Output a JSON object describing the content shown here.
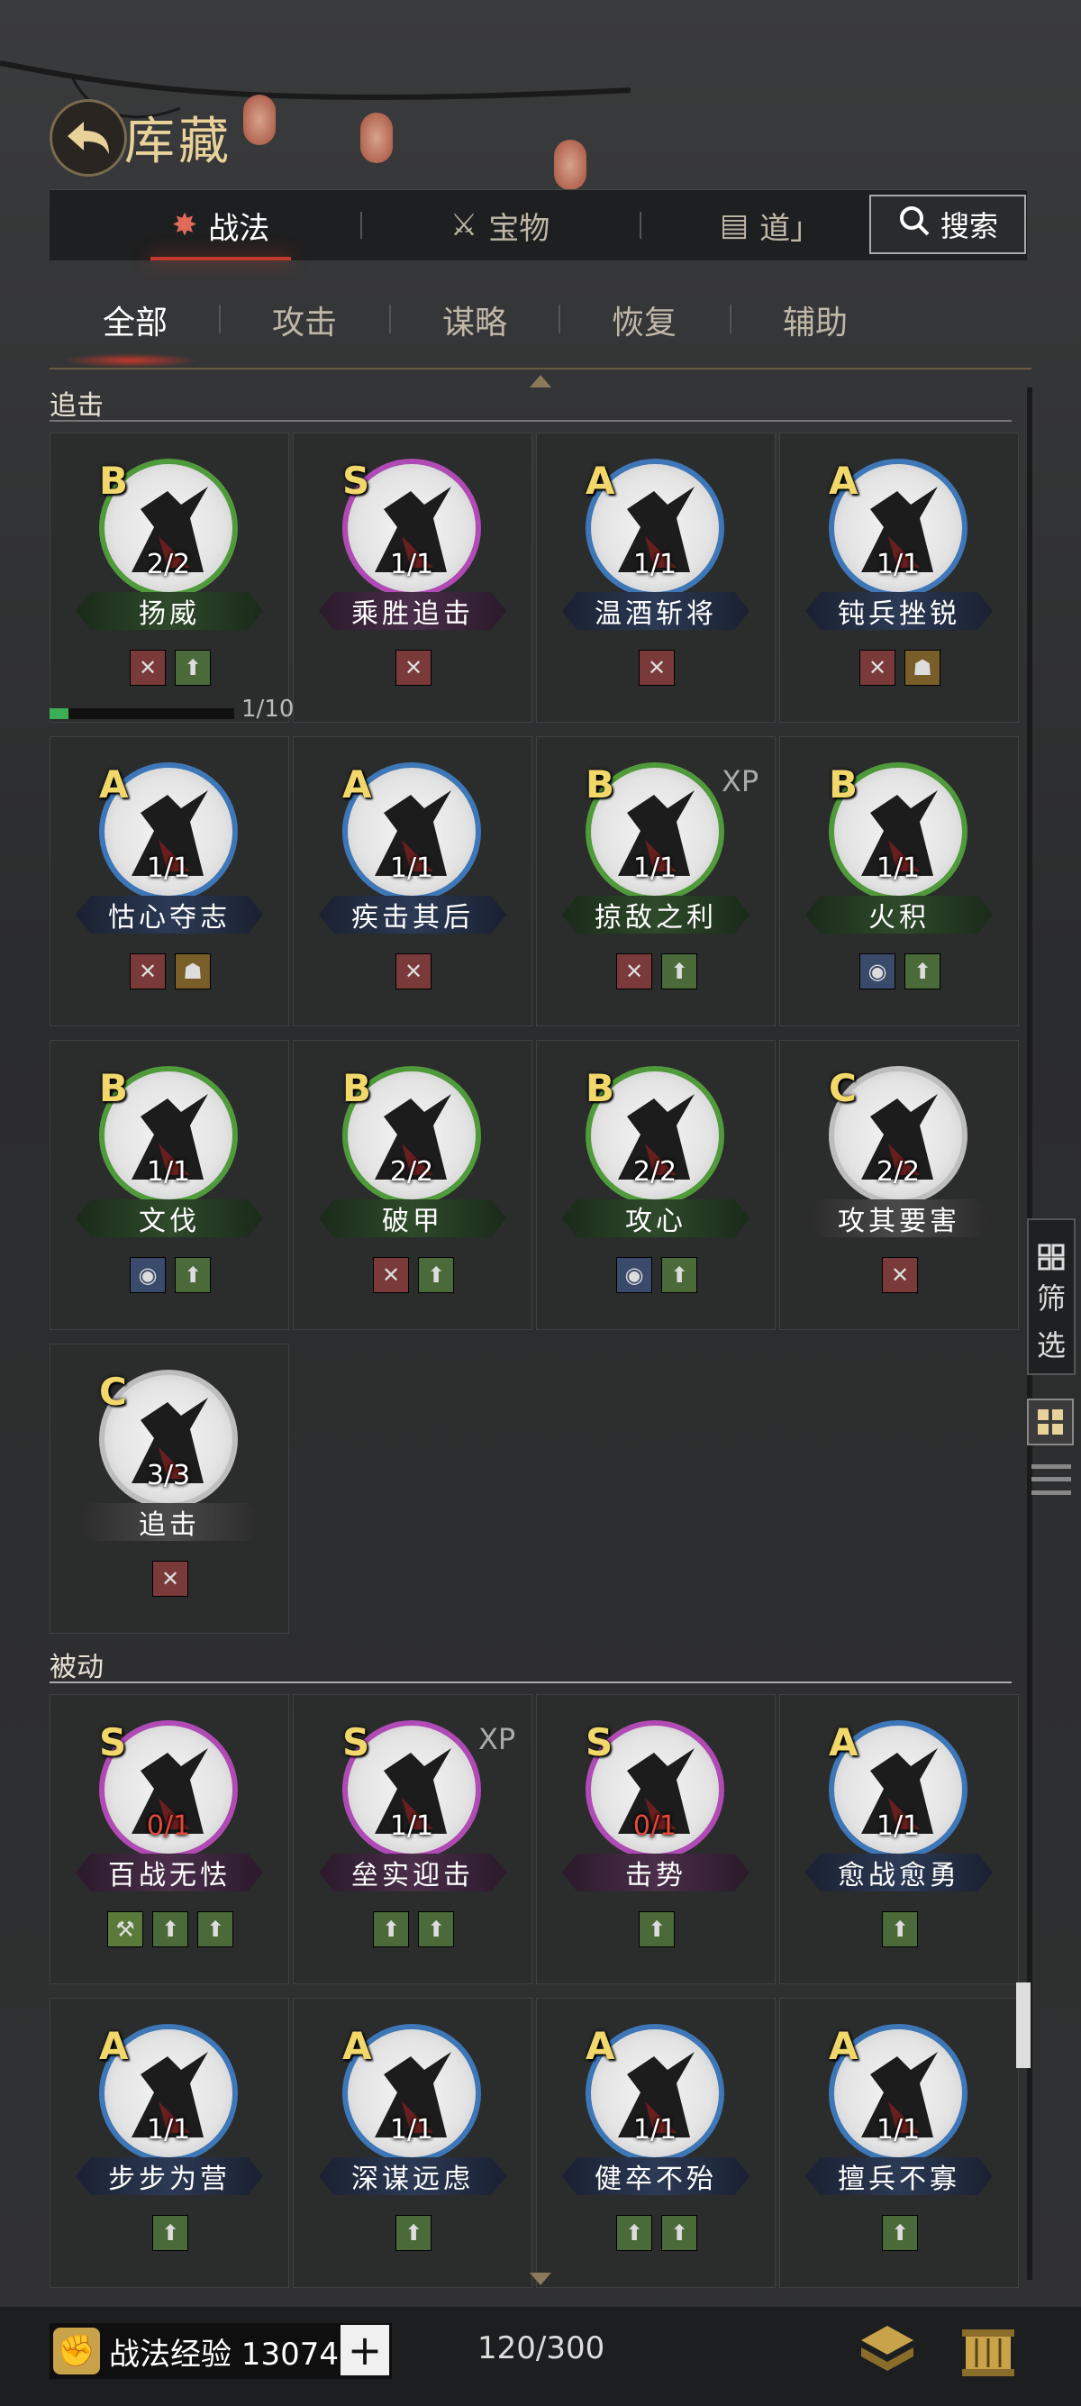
{
  "header": {
    "title": "库藏"
  },
  "tabs": [
    {
      "label": "战法",
      "active": true
    },
    {
      "label": "宝物",
      "active": false
    },
    {
      "label": "道」",
      "active": false
    }
  ],
  "search": {
    "label": "搜索"
  },
  "subtabs": [
    {
      "label": "全部",
      "active": true
    },
    {
      "label": "攻击",
      "active": false
    },
    {
      "label": "谋略",
      "active": false
    },
    {
      "label": "恢复",
      "active": false
    },
    {
      "label": "辅助",
      "active": false
    }
  ],
  "sections": [
    {
      "label": "追击",
      "cards": [
        {
          "grade": "B",
          "count": "2/2",
          "name": "扬威",
          "tags": [
            "red",
            "green"
          ],
          "progress": {
            "value": 0.1,
            "text": "1/10"
          }
        },
        {
          "grade": "S",
          "count": "1/1",
          "name": "乘胜追击",
          "tags": [
            "red"
          ]
        },
        {
          "grade": "A",
          "count": "1/1",
          "name": "温酒斩将",
          "tags": [
            "red"
          ]
        },
        {
          "grade": "A",
          "count": "1/1",
          "name": "钝兵挫锐",
          "tags": [
            "red",
            "gold"
          ]
        },
        {
          "grade": "A",
          "count": "1/1",
          "name": "怙心夺志",
          "tags": [
            "red",
            "gold"
          ]
        },
        {
          "grade": "A",
          "count": "1/1",
          "name": "疾击其后",
          "tags": [
            "red"
          ]
        },
        {
          "grade": "B",
          "count": "1/1",
          "name": "掠敌之利",
          "tags": [
            "red",
            "green"
          ],
          "xp": "XP"
        },
        {
          "grade": "B",
          "count": "1/1",
          "name": "火积",
          "tags": [
            "blue",
            "green"
          ]
        },
        {
          "grade": "B",
          "count": "1/1",
          "name": "文伐",
          "tags": [
            "blue",
            "green"
          ]
        },
        {
          "grade": "B",
          "count": "2/2",
          "name": "破甲",
          "tags": [
            "red",
            "green"
          ]
        },
        {
          "grade": "B",
          "count": "2/2",
          "name": "攻心",
          "tags": [
            "blue",
            "green"
          ]
        },
        {
          "grade": "C",
          "count": "2/2",
          "name": "攻其要害",
          "tags": [
            "red"
          ]
        },
        {
          "grade": "C",
          "count": "3/3",
          "name": "追击",
          "tags": [
            "red"
          ]
        }
      ]
    },
    {
      "label": "被动",
      "cards": [
        {
          "grade": "S",
          "count": "0/1",
          "name": "百战无怯",
          "tags": [
            "olive",
            "green",
            "green"
          ],
          "red_count": true
        },
        {
          "grade": "S",
          "count": "1/1",
          "name": "垒实迎击",
          "tags": [
            "green",
            "green"
          ],
          "xp": "XP"
        },
        {
          "grade": "S",
          "count": "0/1",
          "name": "击势",
          "tags": [
            "green"
          ],
          "red_count": true
        },
        {
          "grade": "A",
          "count": "1/1",
          "name": "愈战愈勇",
          "tags": [
            "green"
          ]
        },
        {
          "grade": "A",
          "count": "1/1",
          "name": "步步为营",
          "tags": [
            "green"
          ]
        },
        {
          "grade": "A",
          "count": "1/1",
          "name": "深谋远虑",
          "tags": [
            "green"
          ]
        },
        {
          "grade": "A",
          "count": "1/1",
          "name": "健卒不殆",
          "tags": [
            "green",
            "green"
          ]
        },
        {
          "grade": "A",
          "count": "1/1",
          "name": "擅兵不寡",
          "tags": [
            "green"
          ]
        }
      ]
    }
  ],
  "filter": {
    "label_1": "筛",
    "label_2": "选"
  },
  "bottom": {
    "exp_label": "战法经验 13074",
    "plus": "+",
    "capacity": "120/300"
  },
  "colors": {
    "accent": "#c0392b",
    "gradeB": "#4f9a3a",
    "gradeS": "#b04ab5",
    "gradeA": "#3d77b8",
    "gradeC": "#bdbdbd",
    "title": "#e8d29a"
  }
}
